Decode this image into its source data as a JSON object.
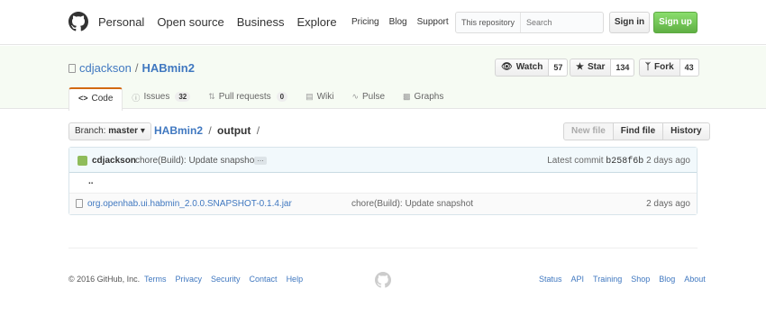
{
  "header": {
    "nav": [
      "Personal",
      "Open source",
      "Business",
      "Explore"
    ],
    "links": [
      "Pricing",
      "Blog",
      "Support"
    ],
    "search_scope": "This repository",
    "search_placeholder": "Search",
    "signin": "Sign in",
    "signup": "Sign up"
  },
  "repo": {
    "owner": "cdjackson",
    "separator": "/",
    "name": "HABmin2",
    "watch_label": "Watch",
    "watch_count": "57",
    "star_label": "Star",
    "star_count": "134",
    "fork_label": "Fork",
    "fork_count": "43"
  },
  "tabs": [
    {
      "label": "Code",
      "icon": "code-icon"
    },
    {
      "label": "Issues",
      "icon": "issue-icon",
      "count": "32"
    },
    {
      "label": "Pull requests",
      "icon": "pull-request-icon",
      "count": "0"
    },
    {
      "label": "Wiki",
      "icon": "book-icon"
    },
    {
      "label": "Pulse",
      "icon": "pulse-icon"
    },
    {
      "label": "Graphs",
      "icon": "graph-icon"
    }
  ],
  "filenav": {
    "branch_prefix": "Branch:",
    "branch": "master",
    "path_root": "HABmin2",
    "path_sep": "/",
    "path_current": "output",
    "path_trailing": "/",
    "new_file": "New file",
    "find_file": "Find file",
    "history": "History"
  },
  "commit": {
    "author": "cdjackson",
    "message": "chore(Build): Update snapshot",
    "ellipsis": "…",
    "latest_label": "Latest commit",
    "sha": "b258f6b",
    "age": "2 days ago"
  },
  "files": {
    "parent": "..",
    "rows": [
      {
        "name": "org.openhab.ui.habmin_2.0.0.SNAPSHOT-0.1.4.jar",
        "message": "chore(Build): Update snapshot",
        "age": "2 days ago"
      }
    ]
  },
  "footer": {
    "copyright": "© 2016 GitHub, Inc.",
    "left_links": [
      "Terms",
      "Privacy",
      "Security",
      "Contact",
      "Help"
    ],
    "right_links": [
      "Status",
      "API",
      "Training",
      "Shop",
      "Blog",
      "About"
    ]
  },
  "colors": {
    "link": "#4078c0",
    "signup_green": "#60b044",
    "tab_accent": "#d26911"
  }
}
